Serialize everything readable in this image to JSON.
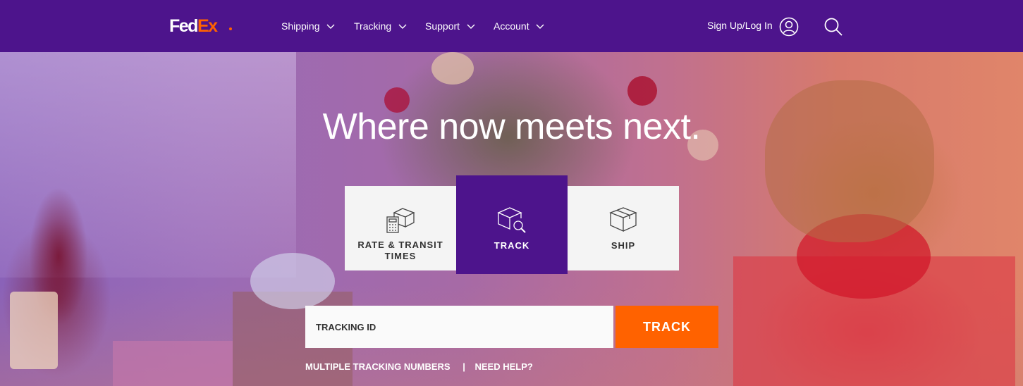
{
  "header": {
    "logo": {
      "part1": "Fed",
      "part2": "Ex"
    },
    "nav": [
      {
        "label": "Shipping"
      },
      {
        "label": "Tracking"
      },
      {
        "label": "Support"
      },
      {
        "label": "Account"
      }
    ],
    "signin_label": "Sign Up/Log In"
  },
  "hero": {
    "headline": "Where now meets next."
  },
  "tabs": [
    {
      "label": "RATE & TRANSIT TIMES",
      "icon": "calculator-box-icon",
      "active": false
    },
    {
      "label": "TRACK",
      "icon": "box-magnifier-icon",
      "active": true
    },
    {
      "label": "SHIP",
      "icon": "box-icon",
      "active": false
    }
  ],
  "tracking": {
    "placeholder": "TRACKING ID",
    "value": "",
    "button_label": "TRACK",
    "links": [
      {
        "label": "MULTIPLE TRACKING NUMBERS"
      },
      {
        "label": "NEED HELP?"
      }
    ],
    "separator": "|"
  },
  "colors": {
    "brand_purple": "#4d148c",
    "brand_orange": "#ff6200",
    "tile_bg": "#f4f4f4"
  }
}
